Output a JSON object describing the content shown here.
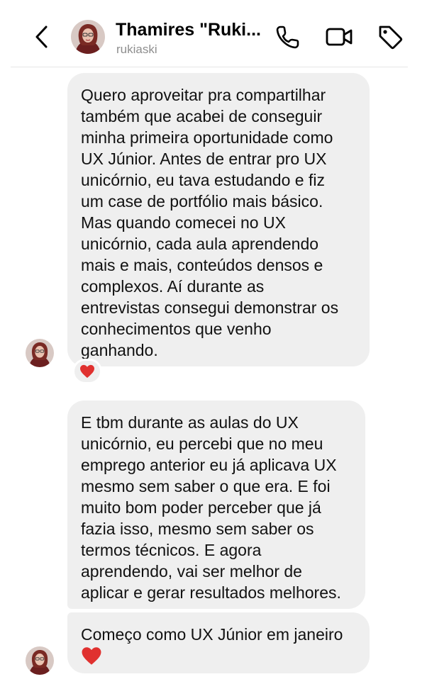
{
  "header": {
    "contact_name": "Thamires \"Ruki...",
    "username": "rukiaski"
  },
  "messages": [
    {
      "text": "Quero aproveitar pra compartilhar\ntambém que acabei de conseguir\nminha primeira oportunidade como\nUX Júnior. Antes de entrar pro UX\nunicórnio, eu tava estudando e fiz\num case de portfólio mais básico.\nMas quando comecei no UX\nunicórnio, cada aula aprendendo\nmais e mais, conteúdos densos e\ncomplexos. Aí durante as\nentrevistas consegui demonstrar os\nconhecimentos que venho\nganhando.",
      "reaction": "heart-icon"
    },
    {
      "text": "E tbm durante as aulas do UX\nunicórnio, eu percebi que no meu\nemprego anterior eu já aplicava UX\nmesmo sem saber o que era. E foi\nmuito bom poder perceber que já\nfazia isso, mesmo sem saber os\ntermos técnicos. E agora\naprendendo, vai ser melhor de\naplicar e gerar resultados melhores."
    },
    {
      "text": "Começo como UX Júnior em janeiro",
      "trailing_emoji": "heart-icon"
    }
  ],
  "colors": {
    "bubble": "#efefef",
    "heart": "#e0312f",
    "secondary_text": "#8e8e8e"
  }
}
